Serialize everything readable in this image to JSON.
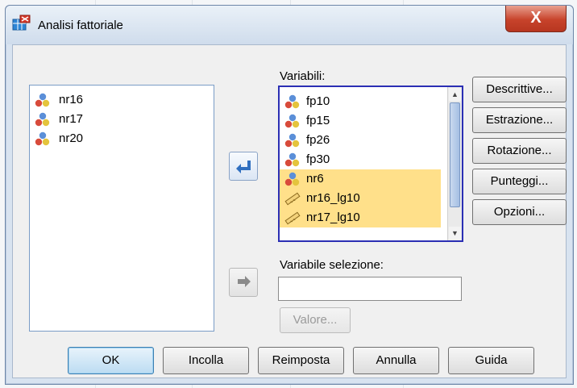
{
  "window": {
    "title": "Analisi fattoriale",
    "close_glyph": "X"
  },
  "source_list": {
    "items": [
      {
        "label": "nr16",
        "icon": "nominal-variable-icon"
      },
      {
        "label": "nr17",
        "icon": "nominal-variable-icon"
      },
      {
        "label": "nr20",
        "icon": "nominal-variable-icon"
      }
    ]
  },
  "variables": {
    "label": "Variabili:",
    "items": [
      {
        "label": "fp10",
        "icon": "nominal-variable-icon",
        "selected": false
      },
      {
        "label": "fp15",
        "icon": "nominal-variable-icon",
        "selected": false
      },
      {
        "label": "fp26",
        "icon": "nominal-variable-icon",
        "selected": false
      },
      {
        "label": "fp30",
        "icon": "nominal-variable-icon",
        "selected": false
      },
      {
        "label": "nr6",
        "icon": "nominal-variable-icon",
        "selected": true
      },
      {
        "label": "nr16_lg10",
        "icon": "scale-variable-icon",
        "selected": true
      },
      {
        "label": "nr17_lg10",
        "icon": "scale-variable-icon",
        "selected": true
      }
    ]
  },
  "selection_variable": {
    "label": "Variabile selezione:",
    "value": ""
  },
  "value_button": "Valore...",
  "side_buttons": {
    "descriptives": "Descrittive...",
    "extraction": "Estrazione...",
    "rotation": "Rotazione...",
    "scores": "Punteggi...",
    "options": "Opzioni..."
  },
  "bottom_buttons": {
    "ok": "OK",
    "paste": "Incolla",
    "reset": "Reimposta",
    "cancel": "Annulla",
    "help": "Guida"
  },
  "colors": {
    "selection_highlight": "#ffe08a",
    "arrow_active": "#2f6fc0",
    "close_button": "#c7432b"
  }
}
